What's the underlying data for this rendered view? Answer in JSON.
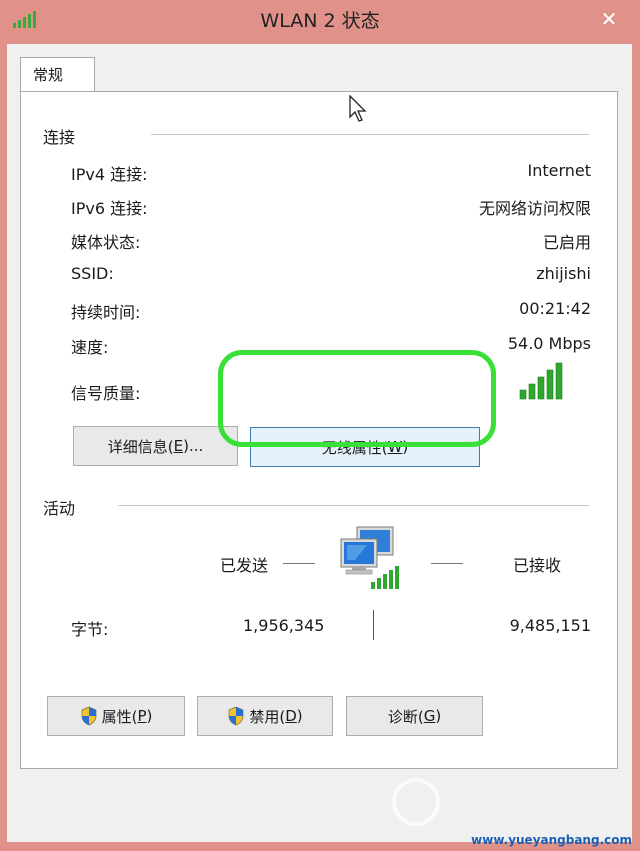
{
  "window": {
    "title": "WLAN 2 状态",
    "close_label": "✕"
  },
  "tabs": [
    {
      "label": "常规"
    }
  ],
  "connection": {
    "section_label": "连接",
    "rows": [
      {
        "label": "IPv4 连接:",
        "value": "Internet"
      },
      {
        "label": "IPv6 连接:",
        "value": "无网络访问权限"
      },
      {
        "label": "媒体状态:",
        "value": "已启用"
      },
      {
        "label": "SSID:",
        "value": "zhijishi"
      },
      {
        "label": "持续时间:",
        "value": "00:21:42"
      },
      {
        "label": "速度:",
        "value": "54.0 Mbps"
      }
    ],
    "signal_label": "信号质量:",
    "signal_bars": 5,
    "details_button": {
      "text": "详细信息(",
      "key": "E",
      "suffix": ")..."
    },
    "wireless_button": {
      "text": "无线属性(",
      "key": "W",
      "suffix": ")"
    }
  },
  "activity": {
    "section_label": "活动",
    "sent_label": "已发送",
    "received_label": "已接收",
    "bytes_label": "字节:",
    "bytes_sent": "1,956,345",
    "bytes_received": "9,485,151"
  },
  "buttons": {
    "properties": {
      "text": "属性(",
      "key": "P",
      "suffix": ")"
    },
    "disable": {
      "text": "禁用(",
      "key": "D",
      "suffix": ")"
    },
    "diagnose": {
      "text": "诊断(",
      "key": "G",
      "suffix": ")"
    }
  },
  "watermark": {
    "text": "www.yueyangbang.com"
  },
  "colors": {
    "window_frame": "#e0928a",
    "highlight": "#38e038",
    "signal": "#2fa82f",
    "focus": "#3c7fb1"
  }
}
